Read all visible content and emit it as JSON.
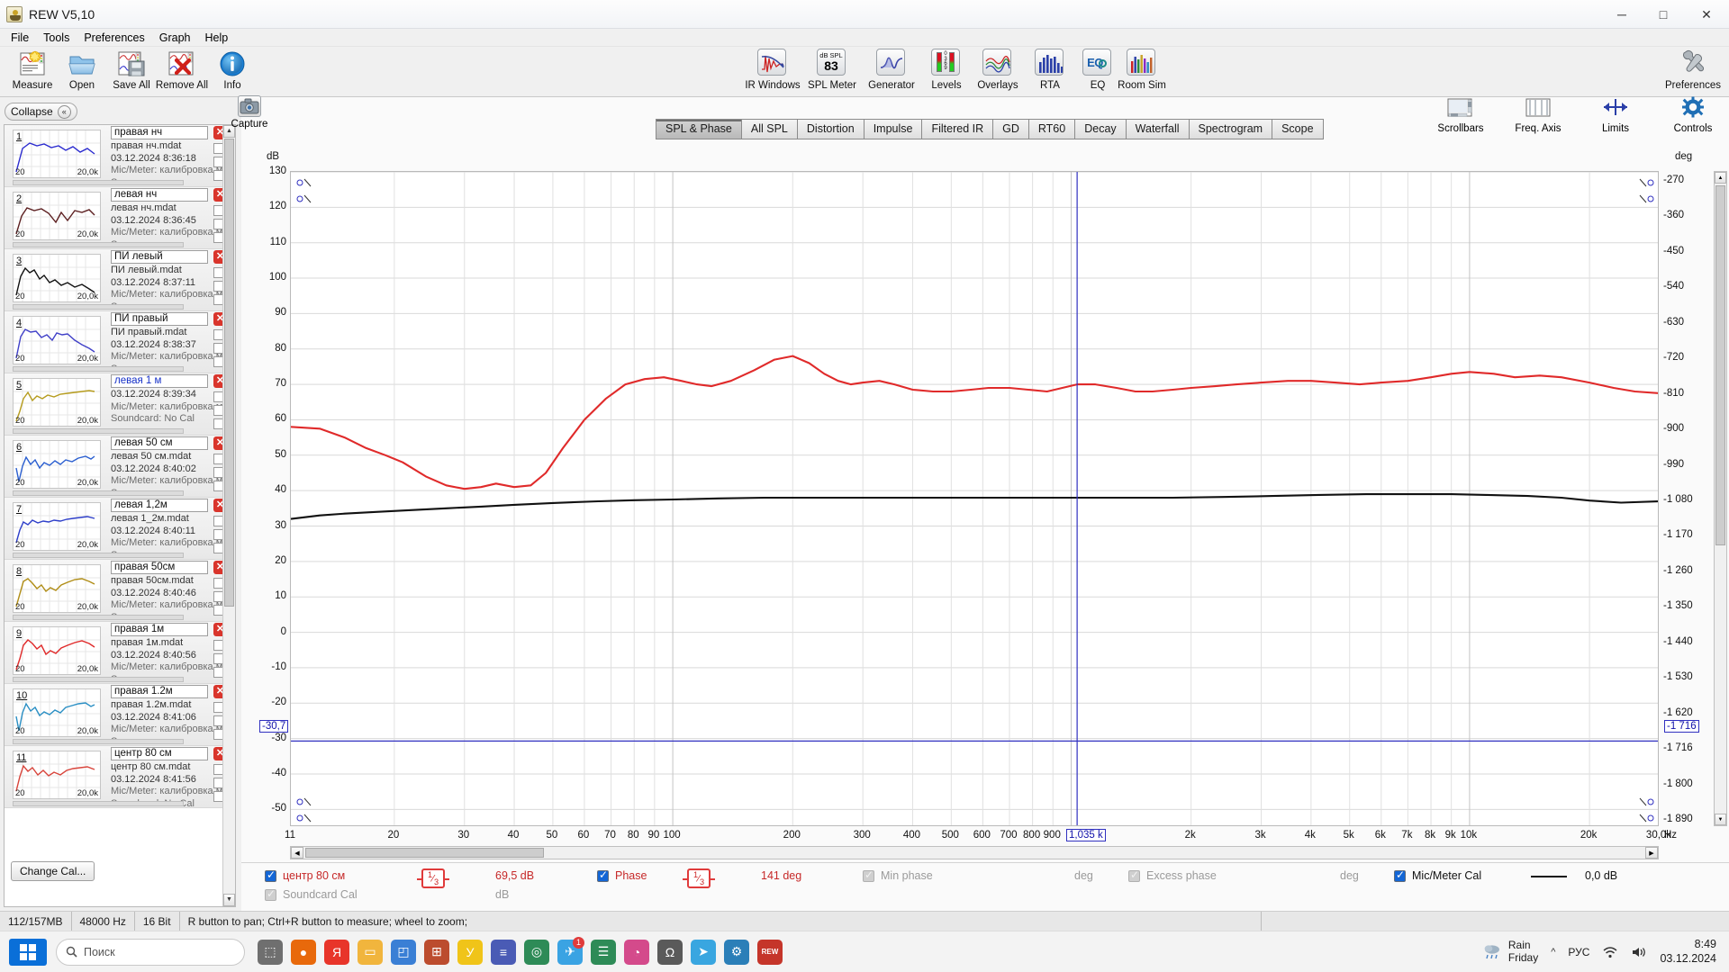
{
  "window": {
    "title": "REW V5,10",
    "app_icon": "java-coffee-icon",
    "minimize": "─",
    "maximize": "□",
    "close": "✕"
  },
  "menu": {
    "items": [
      "File",
      "Tools",
      "Preferences",
      "Graph",
      "Help"
    ]
  },
  "toolbar": {
    "left_items": [
      {
        "label": "Measure",
        "icon": "measure-icon"
      },
      {
        "label": "Open",
        "icon": "folder-open-icon"
      },
      {
        "label": "Save All",
        "icon": "save-all-icon"
      },
      {
        "label": "Remove All",
        "icon": "remove-all-icon"
      },
      {
        "label": "Info",
        "icon": "info-icon"
      }
    ],
    "center_items": [
      {
        "label": "IR Windows",
        "icon": "ir-windows-icon"
      },
      {
        "label": "SPL Meter",
        "icon": "spl-meter-icon",
        "badge_top": "dB SPL",
        "badge_value": "83"
      },
      {
        "label": "Generator",
        "icon": "generator-icon"
      },
      {
        "label": "Levels",
        "icon": "levels-icon"
      },
      {
        "label": "Overlays",
        "icon": "overlays-icon"
      },
      {
        "label": "RTA",
        "icon": "rta-icon"
      },
      {
        "label": "EQ",
        "icon": "eq-icon"
      },
      {
        "label": "Room Sim",
        "icon": "room-sim-icon"
      }
    ],
    "right_items": [
      {
        "label": "Preferences",
        "icon": "wrench-icon"
      }
    ]
  },
  "sidebar": {
    "collapse_label": "Collapse",
    "collapse_icon": "chevron-double-left-icon",
    "change_cal_label": "Change Cal...",
    "measurements": [
      {
        "index": "1",
        "name": "правая нч",
        "file": "правая нч.mdat",
        "date": "03.12.2024 8:36:18",
        "cal": "Mic/Meter: калибровка м",
        "soundcard": "S",
        "color": "#2b2bcf",
        "thumb_min": "20",
        "thumb_max": "20,0k"
      },
      {
        "index": "2",
        "name": "левая нч",
        "file": "левая нч.mdat",
        "date": "03.12.2024 8:36:45",
        "cal": "Mic/Meter: калибровка м",
        "soundcard": "S",
        "color": "#5c1f20",
        "thumb_min": "20",
        "thumb_max": "20,0k"
      },
      {
        "index": "3",
        "name": "ПИ левый",
        "file": "ПИ левый.mdat",
        "date": "03.12.2024 8:37:11",
        "cal": "Mic/Meter: калибровка м",
        "soundcard": "S",
        "color": "#111111",
        "thumb_min": "20",
        "thumb_max": "20,0k"
      },
      {
        "index": "4",
        "name": "ПИ правый",
        "file": "ПИ правый.mdat",
        "date": "03.12.2024 8:38:37",
        "cal": "Mic/Meter: калибровка м",
        "soundcard": "S",
        "color": "#4040c8",
        "thumb_min": "20",
        "thumb_max": "20,0k"
      },
      {
        "index": "5",
        "name": "левая 1 м",
        "file": "",
        "date": "03.12.2024 8:39:34",
        "cal": "Mic/Meter: калибровка м",
        "soundcard": "Soundcard: No Cal",
        "color": "#b59b1c",
        "thumb_min": "20",
        "thumb_max": "20,0k",
        "selected": true
      },
      {
        "index": "6",
        "name": "левая 50 см",
        "file": "левая 50 см.mdat",
        "date": "03.12.2024 8:40:02",
        "cal": "Mic/Meter: калибровка м",
        "soundcard": "S",
        "color": "#2b5fd0",
        "thumb_min": "20",
        "thumb_max": "20,0k"
      },
      {
        "index": "7",
        "name": "левая 1,2м",
        "file": "левая 1_2м.mdat",
        "date": "03.12.2024 8:40:11",
        "cal": "Mic/Meter: калибровка м",
        "soundcard": "S",
        "color": "#2d3ec9",
        "thumb_min": "20",
        "thumb_max": "20,0k"
      },
      {
        "index": "8",
        "name": "правая 50см",
        "file": "правая 50см.mdat",
        "date": "03.12.2024 8:40:46",
        "cal": "Mic/Meter: калибровка м",
        "soundcard": "S",
        "color": "#b08d16",
        "thumb_min": "20",
        "thumb_max": "20,0k"
      },
      {
        "index": "9",
        "name": "правая 1м",
        "file": "правая 1м.mdat",
        "date": "03.12.2024 8:40:56",
        "cal": "Mic/Meter: калибровка м",
        "soundcard": "S",
        "color": "#e02a2a",
        "thumb_min": "20",
        "thumb_max": "20,0k"
      },
      {
        "index": "10",
        "name": "правая 1.2м",
        "file": "правая 1.2м.mdat",
        "date": "03.12.2024 8:41:06",
        "cal": "Mic/Meter: калибровка м",
        "soundcard": "S",
        "color": "#2a8fc4",
        "thumb_min": "20",
        "thumb_max": "20,0k"
      },
      {
        "index": "11",
        "name": "центр 80 см",
        "file": "центр 80 см.mdat",
        "date": "03.12.2024 8:41:56",
        "cal": "Mic/Meter: калибровка м",
        "soundcard": "Soundcard: No Cal",
        "color": "#d8443b",
        "thumb_min": "20",
        "thumb_max": "20,0k"
      }
    ],
    "remove_icon": "close-circle-icon"
  },
  "graph": {
    "capture_label": "Capture",
    "capture_icon": "camera-icon",
    "tabs": [
      {
        "label": "SPL & Phase",
        "active": true
      },
      {
        "label": "All SPL",
        "active": false
      },
      {
        "label": "Distortion",
        "active": false
      },
      {
        "label": "Impulse",
        "active": false
      },
      {
        "label": "Filtered IR",
        "active": false
      },
      {
        "label": "GD",
        "active": false
      },
      {
        "label": "RT60",
        "active": false
      },
      {
        "label": "Decay",
        "active": false
      },
      {
        "label": "Waterfall",
        "active": false
      },
      {
        "label": "Spectrogram",
        "active": false
      },
      {
        "label": "Scope",
        "active": false
      }
    ],
    "right_controls": [
      {
        "label": "Scrollbars",
        "icon": "scrollbars-icon"
      },
      {
        "label": "Freq. Axis",
        "icon": "freq-axis-icon"
      },
      {
        "label": "Limits",
        "icon": "limits-icon"
      },
      {
        "label": "Controls",
        "icon": "gear-icon"
      }
    ],
    "cursor": {
      "freq_label": "1,035 k",
      "spl_label": "-30,7",
      "phase_label": "-1 716"
    }
  },
  "chart_data": {
    "type": "line",
    "title": "SPL & Phase",
    "ylabel": "dB",
    "y2label": "deg",
    "xlabel": "Hz",
    "grid": true,
    "ylim": [
      -55,
      130
    ],
    "y2lim": [
      -1935,
      -225
    ],
    "xlim": [
      11,
      30000
    ],
    "yticks": [
      130,
      120,
      110,
      100,
      90,
      80,
      70,
      60,
      50,
      40,
      30,
      20,
      10,
      0,
      -10,
      -20,
      -30,
      -40,
      -50
    ],
    "y2ticks": [
      "-270",
      "-360",
      "-450",
      "-540",
      "-630",
      "-720",
      "-810",
      "-900",
      "-990",
      "-1 080",
      "-1 170",
      "-1 260",
      "-1 350",
      "-1 440",
      "-1 530",
      "-1 620",
      "-1 716",
      "-1 800",
      "-1 890"
    ],
    "xticks": [
      "11",
      "20",
      "30",
      "40",
      "50",
      "60",
      "70",
      "80",
      "90",
      "100",
      "200",
      "300",
      "400",
      "500",
      "600",
      "700",
      "800",
      "900",
      "1,035 k",
      "2k",
      "3k",
      "4k",
      "5k",
      "6k",
      "7k",
      "8k",
      "9k",
      "10k",
      "20k",
      "30,0k"
    ],
    "series": [
      {
        "name": "центр 80 см SPL",
        "color": "#e02a2a",
        "axis": "left",
        "points": [
          [
            11,
            58
          ],
          [
            13,
            57.5
          ],
          [
            15,
            55
          ],
          [
            17,
            52
          ],
          [
            19,
            50
          ],
          [
            21,
            48
          ],
          [
            24,
            44
          ],
          [
            27,
            41.5
          ],
          [
            30,
            40.5
          ],
          [
            33,
            41
          ],
          [
            36,
            42
          ],
          [
            40,
            41
          ],
          [
            44,
            41.5
          ],
          [
            48,
            45
          ],
          [
            53,
            52
          ],
          [
            60,
            60
          ],
          [
            68,
            66
          ],
          [
            76,
            70
          ],
          [
            85,
            71.5
          ],
          [
            95,
            72
          ],
          [
            105,
            71
          ],
          [
            115,
            70
          ],
          [
            125,
            69.5
          ],
          [
            140,
            71
          ],
          [
            160,
            74
          ],
          [
            180,
            77
          ],
          [
            200,
            78
          ],
          [
            220,
            76
          ],
          [
            240,
            73
          ],
          [
            260,
            71
          ],
          [
            280,
            70
          ],
          [
            300,
            70.5
          ],
          [
            330,
            71
          ],
          [
            360,
            70
          ],
          [
            400,
            68.5
          ],
          [
            450,
            68
          ],
          [
            500,
            68
          ],
          [
            560,
            68.5
          ],
          [
            620,
            69
          ],
          [
            700,
            69
          ],
          [
            780,
            68.5
          ],
          [
            870,
            68
          ],
          [
            950,
            69
          ],
          [
            1035,
            70
          ],
          [
            1150,
            70
          ],
          [
            1300,
            69
          ],
          [
            1450,
            68
          ],
          [
            1600,
            68
          ],
          [
            1800,
            68.5
          ],
          [
            2000,
            69
          ],
          [
            2300,
            69.5
          ],
          [
            2600,
            70
          ],
          [
            3000,
            70.5
          ],
          [
            3500,
            71
          ],
          [
            4000,
            71
          ],
          [
            4600,
            70.5
          ],
          [
            5300,
            70
          ],
          [
            6000,
            70.5
          ],
          [
            7000,
            71
          ],
          [
            8000,
            72
          ],
          [
            9000,
            73
          ],
          [
            10000,
            73.5
          ],
          [
            11500,
            73
          ],
          [
            13000,
            72
          ],
          [
            15000,
            72.5
          ],
          [
            17000,
            72
          ],
          [
            20000,
            70.5
          ],
          [
            23000,
            69
          ],
          [
            26000,
            68
          ],
          [
            30000,
            67.5
          ]
        ]
      },
      {
        "name": "центр 80 см Phase",
        "color": "#111111",
        "axis": "right",
        "points": [
          [
            11,
            32
          ],
          [
            13,
            33
          ],
          [
            15,
            33.5
          ],
          [
            18,
            34
          ],
          [
            22,
            34.5
          ],
          [
            27,
            35
          ],
          [
            33,
            35.5
          ],
          [
            40,
            36
          ],
          [
            50,
            36.5
          ],
          [
            65,
            37
          ],
          [
            80,
            37.3
          ],
          [
            100,
            37.5
          ],
          [
            130,
            37.8
          ],
          [
            170,
            38
          ],
          [
            220,
            38
          ],
          [
            300,
            38
          ],
          [
            400,
            38
          ],
          [
            550,
            38
          ],
          [
            700,
            38
          ],
          [
            900,
            38
          ],
          [
            1035,
            38
          ],
          [
            1400,
            38
          ],
          [
            1800,
            38
          ],
          [
            2400,
            38.2
          ],
          [
            3200,
            38.5
          ],
          [
            4200,
            38.8
          ],
          [
            5500,
            39
          ],
          [
            7000,
            39
          ],
          [
            9000,
            39
          ],
          [
            11000,
            38.8
          ],
          [
            14000,
            38.5
          ],
          [
            17000,
            38
          ],
          [
            20000,
            37.2
          ],
          [
            24000,
            36.6
          ],
          [
            30000,
            37
          ]
        ]
      }
    ]
  },
  "bottom_controls": {
    "row1": {
      "spl_checkbox_checked": true,
      "spl_label": "центр 80 см",
      "spl_smoothing": {
        "num": "1",
        "den": "3"
      },
      "spl_value": "69,5 dB",
      "phase_checkbox_checked": true,
      "phase_label": "Phase",
      "phase_smoothing": {
        "num": "1",
        "den": "3"
      },
      "phase_value": "141 deg",
      "minphase_checkbox_checked": true,
      "minphase_label": "Min phase",
      "minphase_unit": "deg",
      "excess_checkbox_checked": true,
      "excess_label": "Excess phase",
      "excess_unit": "deg",
      "miccal_checkbox_checked": true,
      "miccal_label": "Mic/Meter Cal",
      "miccal_value": "0,0 dB"
    },
    "row2": {
      "soundcard_checkbox_checked": true,
      "soundcard_label": "Soundcard Cal",
      "soundcard_unit": "dB"
    }
  },
  "statusbar": {
    "memory": "112/157MB",
    "samplerate": "48000 Hz",
    "bitdepth": "16 Bit",
    "hint": "R button to pan; Ctrl+R button to measure; wheel to zoom;"
  },
  "taskbar": {
    "start_icon": "windows-start-icon",
    "search_placeholder": "Поиск",
    "search_icon": "search-icon",
    "apps": [
      {
        "name": "task-view-icon",
        "color": "#6f6f6f",
        "glyph": "⬚"
      },
      {
        "name": "firefox-icon",
        "color": "#e8690b",
        "glyph": "●"
      },
      {
        "name": "yandex-browser-icon",
        "color": "#e8352a",
        "glyph": "Я"
      },
      {
        "name": "file-explorer-icon",
        "color": "#f1b53d",
        "glyph": "▭"
      },
      {
        "name": "photos-icon",
        "color": "#3a7fd5",
        "glyph": "◰"
      },
      {
        "name": "calculator-icon",
        "color": "#bc4c2e",
        "glyph": "⊞"
      },
      {
        "name": "yandex-music-icon",
        "color": "#f0c419",
        "glyph": "У"
      },
      {
        "name": "equalizer-icon",
        "color": "#4a5bb5",
        "glyph": "≡"
      },
      {
        "name": "chrome-icon",
        "color": "#2e8b57",
        "glyph": "◎"
      },
      {
        "name": "telegram-app-icon",
        "color": "#3aa3e3",
        "glyph": "✈",
        "badge": "1"
      },
      {
        "name": "notepad-icon",
        "color": "#2e8b57",
        "glyph": "☰"
      },
      {
        "name": "color-wheel-icon",
        "color": "#d44a8b",
        "glyph": "◔"
      },
      {
        "name": "audio-tool-icon",
        "color": "#5a5a5a",
        "glyph": "Ω"
      },
      {
        "name": "telegram-icon",
        "color": "#39a6e0",
        "glyph": "➤"
      },
      {
        "name": "settings-icon",
        "color": "#2b7fb8",
        "glyph": "⚙"
      },
      {
        "name": "rew-icon",
        "color": "#c5352a",
        "glyph": "REW"
      }
    ],
    "weather": {
      "temp_icon": "rain-icon",
      "condition": "Rain",
      "day": "Friday"
    },
    "tray": {
      "expand_icon": "chevron-up-icon",
      "language": "РУС",
      "wifi_icon": "wifi-icon",
      "volume_icon": "volume-icon",
      "time": "8:49",
      "date": "03.12.2024"
    }
  }
}
